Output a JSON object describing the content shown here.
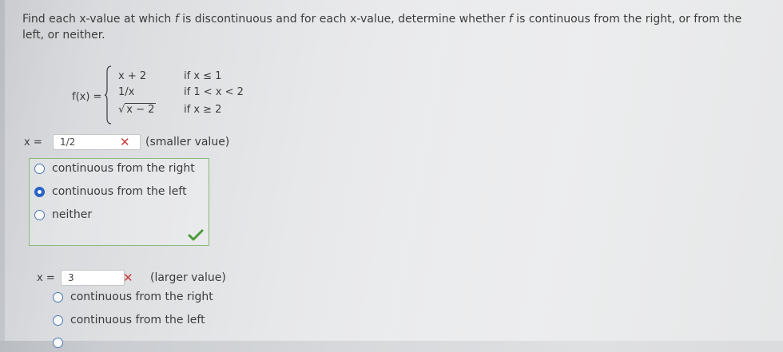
{
  "question": {
    "text_1": "Find each x-value at which ",
    "f1": "f",
    "text_2": " is discontinuous and for each x-value, determine whether ",
    "f2": "f",
    "text_3": " is continuous from the right, or from the left, or neither."
  },
  "function": {
    "name": "f(x) =",
    "cases": [
      {
        "expr": "x + 2",
        "cond": "if x ≤ 1"
      },
      {
        "expr": "1/x",
        "cond": "if 1 < x < 2"
      },
      {
        "expr_radical": "√",
        "expr_radicand": "x − 2",
        "cond": "if x ≥ 2"
      }
    ]
  },
  "part1": {
    "x_label": "x =",
    "x_value": "1/2",
    "status": "incorrect",
    "note": "(smaller value)",
    "options": [
      {
        "label": "continuous from the right",
        "selected": false
      },
      {
        "label": "continuous from the left",
        "selected": true
      },
      {
        "label": "neither",
        "selected": false
      }
    ],
    "options_status": "correct"
  },
  "part2": {
    "x_label": "x =",
    "x_value": "3",
    "status": "incorrect",
    "note": "(larger value)",
    "options": [
      {
        "label": "continuous from the right",
        "selected": false
      },
      {
        "label": "continuous from the left",
        "selected": false
      }
    ]
  },
  "colors": {
    "incorrect": "#c83a3a",
    "correct": "#4a9a3a",
    "radio_selected": "#2a62c8"
  }
}
